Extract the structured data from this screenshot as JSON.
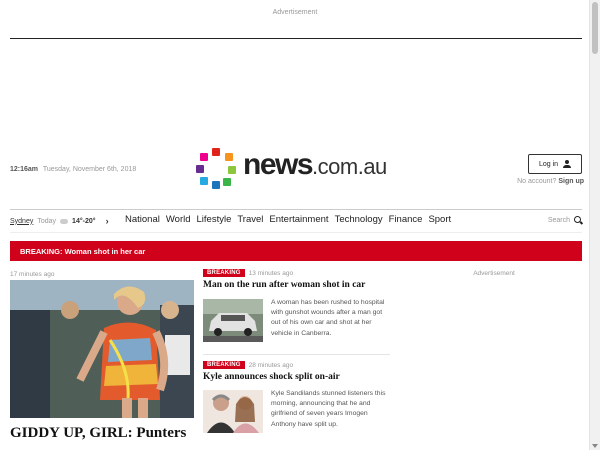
{
  "top_ad": {
    "label": "Advertisement"
  },
  "masthead": {
    "time": "12:16am",
    "date": "Tuesday, November 6th, 2018",
    "logo_name": "news",
    "logo_suffix": ".com.au",
    "login_label": "Log in",
    "no_account_text": "No account?",
    "signup_label": "Sign up"
  },
  "weather": {
    "city": "Sydney",
    "day": "Today",
    "temps": "14°-20°"
  },
  "nav": {
    "items": [
      "National",
      "World",
      "Lifestyle",
      "Travel",
      "Entertainment",
      "Technology",
      "Finance",
      "Sport"
    ],
    "search_label": "Search"
  },
  "breaking_bar": {
    "text": "BREAKING: Woman shot in her car"
  },
  "hero": {
    "time": "17 minutes ago",
    "headline": "GIDDY UP, GIRL: Punters"
  },
  "stories": [
    {
      "badge": "BREAKING",
      "time": "13 minutes ago",
      "title": "Man on the run after woman shot in car",
      "summary": "A woman has been rushed to hospital with gunshot wounds after a man got out of his own car and shot at her vehicle in Canberra."
    },
    {
      "badge": "BREAKING",
      "time": "28 minutes ago",
      "title": "Kyle announces shock split on-air",
      "summary": "Kyle Sandilands stunned listeners this morning, announcing that he and girlfriend of seven years Imogen Anthony have split up."
    }
  ],
  "side_ad": {
    "label": "Advertisement"
  },
  "colors": {
    "accent": "#d0021b",
    "text": "#222222",
    "muted": "#999999"
  },
  "icons": {
    "login": "user-icon",
    "search": "search-icon",
    "nav_next": "chevron-right-icon",
    "weather": "cloud-icon"
  }
}
